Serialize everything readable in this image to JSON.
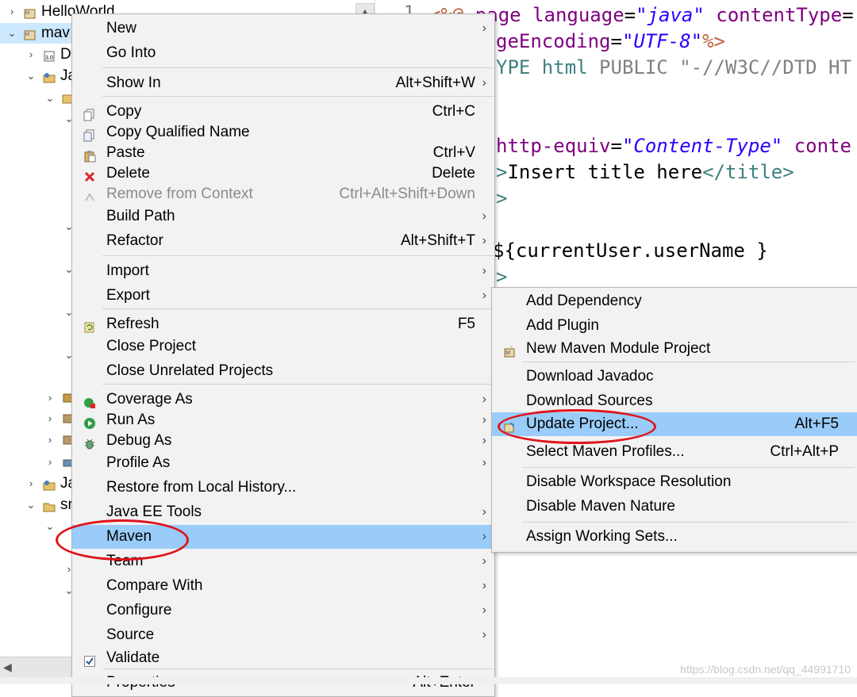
{
  "explorer": {
    "rows": [
      {
        "label": "HelloWorld"
      },
      {
        "label": "mav"
      },
      {
        "label": "D"
      },
      {
        "label": "Ja"
      },
      {
        "label": "Ja"
      },
      {
        "label": "sr"
      }
    ]
  },
  "editor": {
    "line_number": "1",
    "lines": [
      {
        "segments": [
          [
            "c-jsp",
            "<%@ "
          ],
          [
            "c-attr",
            "page "
          ],
          [
            "c-attr",
            "language"
          ],
          [
            "c-text",
            "="
          ],
          [
            "c-val",
            "\"java\""
          ],
          [
            "c-text",
            " "
          ],
          [
            "c-attr",
            "contentType"
          ],
          [
            "c-text",
            "="
          ]
        ]
      },
      {
        "segments": [
          [
            "c-attr",
            "geEncoding"
          ],
          [
            "c-text",
            "="
          ],
          [
            "c-val",
            "\"UTF-8\""
          ],
          [
            "c-jsp",
            "%>"
          ]
        ]
      },
      {
        "segments": [
          [
            "c-tag",
            "YPE html "
          ],
          [
            "c-gray",
            "PUBLIC "
          ],
          [
            "c-gray",
            "\"-//W3C//DTD HT"
          ]
        ]
      },
      {
        "segments": [
          [
            "c-attr",
            "http-equiv"
          ],
          [
            "c-text",
            "="
          ],
          [
            "c-val",
            "\"Content-Type\""
          ],
          [
            "c-text",
            " "
          ],
          [
            "c-attr",
            "conte"
          ]
        ]
      },
      {
        "segments": [
          [
            "c-tag",
            ">"
          ],
          [
            "c-text",
            "Insert title here"
          ],
          [
            "c-tag",
            "</title>"
          ]
        ]
      },
      {
        "segments": [
          [
            "c-tag",
            ">"
          ]
        ]
      },
      {
        "segments": [
          [
            "c-text",
            "${currentUser.userName }"
          ]
        ]
      },
      {
        "segments": [
          [
            "c-tag",
            ">"
          ]
        ]
      }
    ]
  },
  "context_menu": {
    "items": [
      {
        "label": "New",
        "shortcut": "",
        "submenu": true,
        "icon": ""
      },
      {
        "label": "Go Into",
        "shortcut": "",
        "submenu": false,
        "icon": ""
      },
      {
        "label": "Show In",
        "shortcut": "Alt+Shift+W",
        "submenu": true,
        "icon": ""
      },
      {
        "label": "Copy",
        "shortcut": "Ctrl+C",
        "submenu": false,
        "icon": "copy-icon"
      },
      {
        "label": "Copy Qualified Name",
        "shortcut": "",
        "submenu": false,
        "icon": "copy-qualified-icon"
      },
      {
        "label": "Paste",
        "shortcut": "Ctrl+V",
        "submenu": false,
        "icon": "paste-icon"
      },
      {
        "label": "Delete",
        "shortcut": "Delete",
        "submenu": false,
        "icon": "delete-icon"
      },
      {
        "label": "Remove from Context",
        "shortcut": "Ctrl+Alt+Shift+Down",
        "submenu": false,
        "icon": "remove-context-icon",
        "disabled": true
      },
      {
        "label": "Build Path",
        "shortcut": "",
        "submenu": true,
        "icon": ""
      },
      {
        "label": "Refactor",
        "shortcut": "Alt+Shift+T",
        "submenu": true,
        "icon": ""
      },
      {
        "label": "Import",
        "shortcut": "",
        "submenu": true,
        "icon": ""
      },
      {
        "label": "Export",
        "shortcut": "",
        "submenu": true,
        "icon": ""
      },
      {
        "label": "Refresh",
        "shortcut": "F5",
        "submenu": false,
        "icon": "refresh-icon"
      },
      {
        "label": "Close Project",
        "shortcut": "",
        "submenu": false,
        "icon": ""
      },
      {
        "label": "Close Unrelated Projects",
        "shortcut": "",
        "submenu": false,
        "icon": ""
      },
      {
        "label": "Coverage As",
        "shortcut": "",
        "submenu": true,
        "icon": "coverage-icon"
      },
      {
        "label": "Run As",
        "shortcut": "",
        "submenu": true,
        "icon": "run-icon"
      },
      {
        "label": "Debug As",
        "shortcut": "",
        "submenu": true,
        "icon": "debug-icon"
      },
      {
        "label": "Profile As",
        "shortcut": "",
        "submenu": true,
        "icon": ""
      },
      {
        "label": "Restore from Local History...",
        "shortcut": "",
        "submenu": false,
        "icon": ""
      },
      {
        "label": "Java EE Tools",
        "shortcut": "",
        "submenu": true,
        "icon": ""
      },
      {
        "label": "Maven",
        "shortcut": "",
        "submenu": true,
        "icon": "",
        "highlighted": true
      },
      {
        "label": "Team",
        "shortcut": "",
        "submenu": true,
        "icon": ""
      },
      {
        "label": "Compare With",
        "shortcut": "",
        "submenu": true,
        "icon": ""
      },
      {
        "label": "Configure",
        "shortcut": "",
        "submenu": true,
        "icon": ""
      },
      {
        "label": "Source",
        "shortcut": "",
        "submenu": true,
        "icon": ""
      },
      {
        "label": "Validate",
        "shortcut": "",
        "submenu": false,
        "icon": "validate-check-icon"
      },
      {
        "label": "Properties",
        "shortcut": "Alt+Enter",
        "submenu": false,
        "icon": ""
      }
    ]
  },
  "maven_submenu": {
    "items": [
      {
        "label": "Add Dependency",
        "shortcut": ""
      },
      {
        "label": "Add Plugin",
        "shortcut": ""
      },
      {
        "label": "New Maven Module Project",
        "shortcut": "",
        "icon": "maven-module-icon"
      },
      {
        "label": "Download Javadoc",
        "shortcut": ""
      },
      {
        "label": "Download Sources",
        "shortcut": ""
      },
      {
        "label": "Update Project...",
        "shortcut": "Alt+F5",
        "icon": "update-project-icon",
        "highlighted": true
      },
      {
        "label": "Select Maven Profiles...",
        "shortcut": "Ctrl+Alt+P"
      },
      {
        "label": "Disable Workspace Resolution",
        "shortcut": ""
      },
      {
        "label": "Disable Maven Nature",
        "shortcut": ""
      },
      {
        "label": "Assign Working Sets...",
        "shortcut": ""
      }
    ]
  },
  "watermark": "https://blog.csdn.net/qq_44991710",
  "colors": {
    "menu_bg": "#f2f2f2",
    "highlight": "#99ccf8",
    "annotation_red": "#e0141c"
  }
}
